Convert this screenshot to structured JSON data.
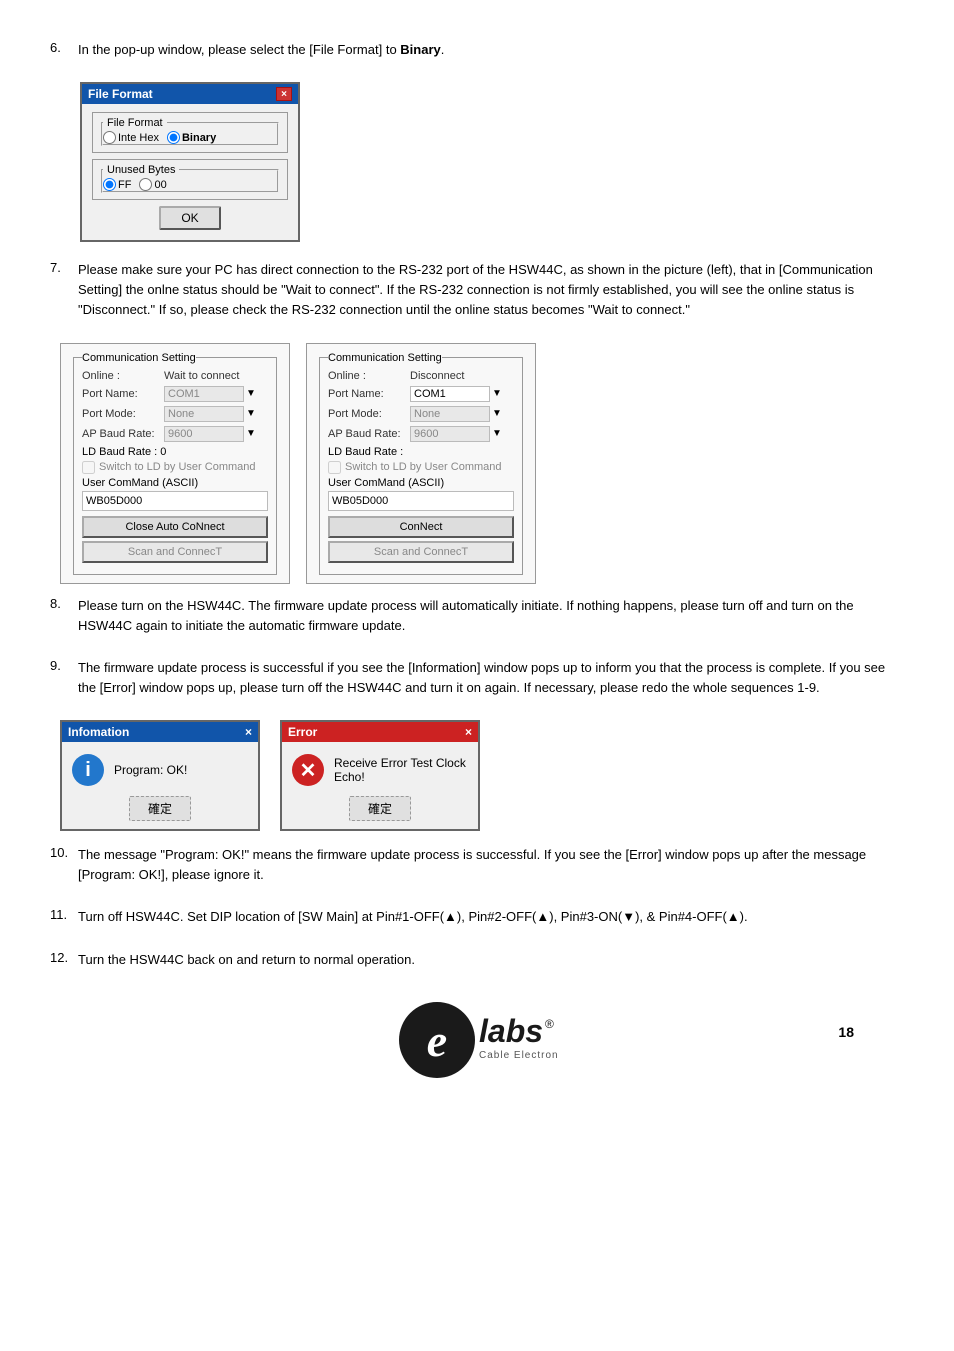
{
  "page": {
    "number": "18"
  },
  "step6": {
    "text": "In the pop-up window, please select the [File Format] to ",
    "bold_text": "Binary",
    "full": "In the pop-up window, please select the [File Format] to Binary."
  },
  "file_format_dialog": {
    "title": "File Format",
    "close_btn": "×",
    "file_format_legend": "File Format",
    "option1_label": "Inte Hex",
    "option2_label": "Binary",
    "unused_bytes_legend": "Unused Bytes",
    "option3_label": "FF",
    "option4_label": "00",
    "ok_btn": "OK"
  },
  "step7": {
    "full": "Please make sure your PC has direct connection to the RS-232 port of the HSW44C, as shown in the picture (left), that in [Communication Setting] the onlne status should be \"Wait to connect\". If the RS-232 connection is not firmly established, you will see the online status is \"Disconnect.\" If so, please check the RS-232 connection until the online status becomes \"Wait to connect.\""
  },
  "comm_left": {
    "legend": "Communication Setting",
    "online_label": "Online :",
    "online_value": "Wait to connect",
    "port_name_label": "Port Name:",
    "port_name_value": "COM1",
    "port_mode_label": "Port Mode:",
    "port_mode_value": "None",
    "ap_baud_label": "AP Baud Rate:",
    "ap_baud_value": "9600",
    "ld_baud_label": "LD Baud Rate : 0",
    "switch_label": "Switch to LD by User Command",
    "ascii_label": "User ComMand (ASCII)",
    "ascii_value": "WB05D000",
    "btn1": "Close Auto CoNnect",
    "btn2": "Scan and ConnecT"
  },
  "comm_right": {
    "legend": "Communication Setting",
    "online_label": "Online :",
    "online_value": "Disconnect",
    "port_name_label": "Port Name:",
    "port_name_value": "COM1",
    "port_mode_label": "Port Mode:",
    "port_mode_value": "None",
    "ap_baud_label": "AP Baud Rate:",
    "ap_baud_value": "9600",
    "ld_baud_label": "LD Baud Rate :",
    "switch_label": "Switch to LD by User Command",
    "ascii_label": "User ComMand (ASCII)",
    "ascii_value": "WB05D000",
    "btn1": "ConNect",
    "btn2": "Scan and ConnecT"
  },
  "step8": {
    "full": "Please turn on the HSW44C. The firmware update process will automatically initiate. If nothing happens, please turn off and turn on the HSW44C again to initiate the automatic firmware update."
  },
  "step9": {
    "full": "The firmware update process is successful if you see the [Information] window pops up to inform you that the process is complete. If you see the [Error] window pops up, please turn off the HSW44C and turn it on again. If necessary, please redo the whole sequences 1-9."
  },
  "info_dialog": {
    "title": "Infomation",
    "close_btn": "×",
    "icon": "i",
    "message": "Program:  OK!",
    "confirm_btn": "確定"
  },
  "error_dialog": {
    "title": "Error",
    "close_btn": "×",
    "icon": "✕",
    "message": "Receive Error Test Clock Echo!",
    "confirm_btn": "確定"
  },
  "step10": {
    "full": "The message \"Program: OK!\" means the firmware update process is successful. If you see the [Error] window pops up after the message [Program: OK!], please ignore it."
  },
  "step11": {
    "pre": "Turn off HSW44C. Set DIP location of [SW Main] at Pin#1-OFF(",
    "up1": "▲",
    "mid1": "), Pin#2-OFF(",
    "up2": "▲",
    "mid2": "), Pin#3-ON(",
    "down1": "▼",
    "mid3": "), & Pin#4-OFF(",
    "up3": "▲",
    "end": ").",
    "full": "Turn off HSW44C. Set DIP location of [SW Main] at Pin#1-OFF(▲), Pin#2-OFF(▲), Pin#3-ON(▼), & Pin#4-OFF(▲)."
  },
  "step12": {
    "full": "Turn the HSW44C back on and return to normal operation."
  },
  "logo": {
    "e_letter": "e",
    "brand": "labs",
    "registered": "®",
    "sub": "Cable Electronics"
  }
}
